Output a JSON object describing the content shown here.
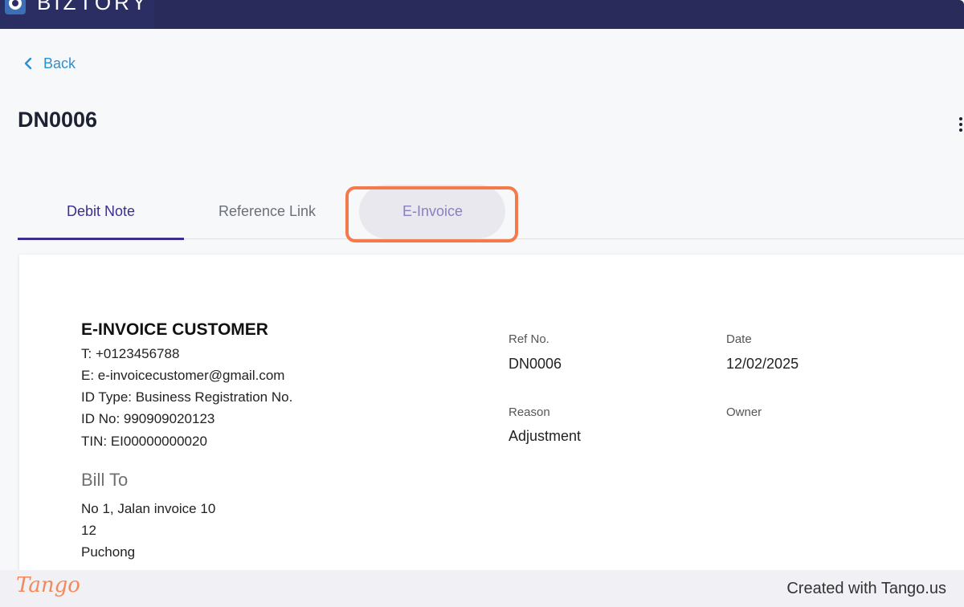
{
  "header": {
    "brand": "BIZTORY"
  },
  "nav": {
    "back_label": "Back"
  },
  "page": {
    "title": "DN0006"
  },
  "tabs": [
    {
      "label": "Debit Note",
      "active": true
    },
    {
      "label": "Reference Link",
      "active": false
    },
    {
      "label": "E-Invoice",
      "active": false
    }
  ],
  "customer": {
    "name": "E-INVOICE CUSTOMER",
    "phone": "T: +0123456788",
    "email": "E: e-invoicecustomer@gmail.com",
    "id_type": "ID Type: Business Registration No.",
    "id_no": "ID No: 990909020123",
    "tin": "TIN: EI00000000020"
  },
  "bill_to": {
    "heading": "Bill To",
    "lines": [
      "No 1, Jalan invoice 10",
      "12",
      "Puchong"
    ]
  },
  "meta": {
    "ref_label": "Ref No.",
    "ref_value": "DN0006",
    "date_label": "Date",
    "date_value": "12/02/2025",
    "reason_label": "Reason",
    "reason_value": "Adjustment",
    "owner_label": "Owner"
  },
  "footer": {
    "logo_text": "Tango",
    "credit": "Created with Tango.us"
  },
  "colors": {
    "topbar": "#292c5a",
    "accent": "#3b2f8f",
    "link": "#2e8fd0",
    "highlight": "#f47a4c"
  }
}
